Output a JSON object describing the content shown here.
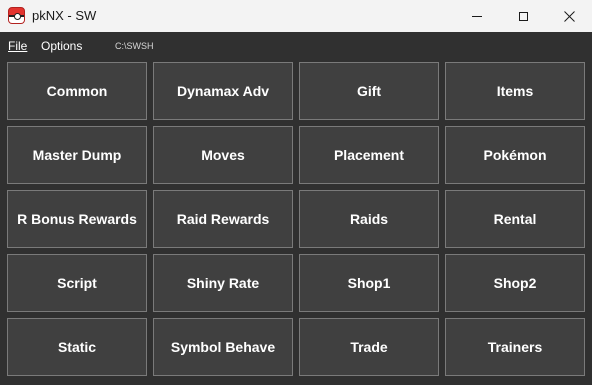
{
  "window": {
    "title": "pkNX - SW",
    "icon": "pokeball-icon"
  },
  "menu": {
    "file_label": "File",
    "options_label": "Options",
    "path": "C:\\SWSH"
  },
  "buttons": [
    "Common",
    "Dynamax Adv",
    "Gift",
    "Items",
    "Master Dump",
    "Moves",
    "Placement",
    "Pokémon",
    "R Bonus Rewards",
    "Raid Rewards",
    "Raids",
    "Rental",
    "Script",
    "Shiny Rate",
    "Shop1",
    "Shop2",
    "Static",
    "Symbol Behave",
    "Trade",
    "Trainers"
  ],
  "colors": {
    "background": "#303030",
    "tile_background": "#404040",
    "tile_border": "#7a7a7a",
    "titlebar": "#f3f3f3",
    "text": "#ffffff"
  }
}
